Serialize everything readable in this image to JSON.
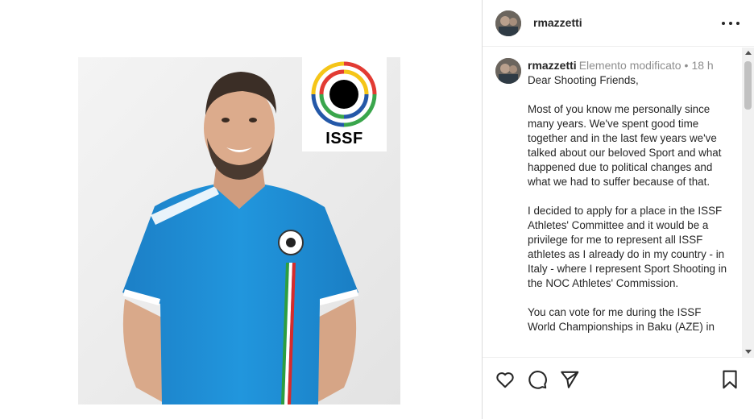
{
  "post": {
    "username": "rmazzetti",
    "logo_text": "ISSF"
  },
  "caption": {
    "username": "rmazzetti",
    "edited": "Elemento modificato",
    "separator": "•",
    "time": "18 h",
    "paragraphs": [
      "Dear Shooting Friends,",
      "Most of you know me personally since many years. We've spent good time together and in the last few years we've talked about our beloved Sport and what happened due to political changes and what we had to suffer because of that.",
      "I decided to apply for a place in the ISSF Athletes' Committee and it would be a privilege for me to represent all ISSF athletes as I already do in my country - in Italy - where I represent Sport Shooting in the NOC Athletes' Commission.",
      "You can vote for me during the ISSF World Championships in Baku (AZE) in"
    ]
  },
  "icons": {
    "more": "more-options-icon",
    "like": "heart-icon",
    "comment": "comment-bubble-icon",
    "share": "paper-plane-icon",
    "save": "bookmark-icon"
  },
  "colors": {
    "jersey": "#1e8fd6",
    "text": "#262626",
    "muted": "#8e8e8e",
    "border": "#dbdbdb"
  }
}
